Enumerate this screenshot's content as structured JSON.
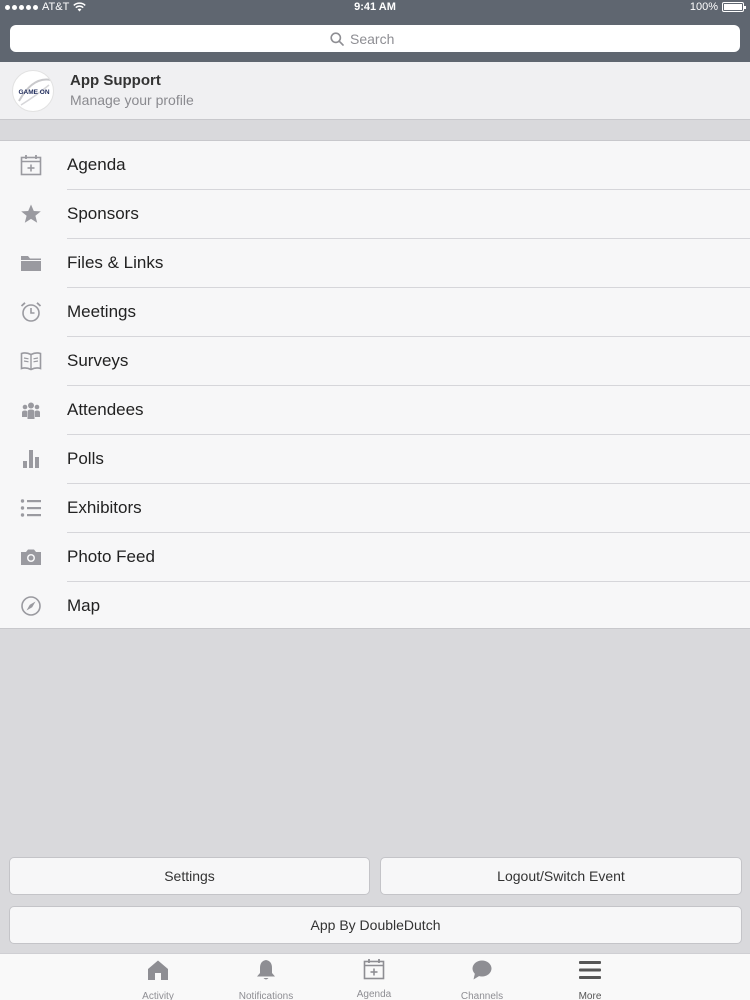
{
  "status_bar": {
    "carrier": "AT&T",
    "time": "9:41 AM",
    "battery": "100%"
  },
  "search": {
    "placeholder": "Search"
  },
  "profile": {
    "avatar_text": "GAME ON",
    "title": "App Support",
    "subtitle": "Manage your profile"
  },
  "menu": {
    "items": [
      {
        "label": "Agenda",
        "icon": "calendar-icon"
      },
      {
        "label": "Sponsors",
        "icon": "star-icon"
      },
      {
        "label": "Files & Links",
        "icon": "folder-icon"
      },
      {
        "label": "Meetings",
        "icon": "alarm-clock-icon"
      },
      {
        "label": "Surveys",
        "icon": "open-book-icon"
      },
      {
        "label": "Attendees",
        "icon": "people-icon"
      },
      {
        "label": "Polls",
        "icon": "bar-chart-icon"
      },
      {
        "label": "Exhibitors",
        "icon": "list-icon"
      },
      {
        "label": "Photo Feed",
        "icon": "camera-icon"
      },
      {
        "label": "Map",
        "icon": "compass-icon"
      }
    ]
  },
  "buttons": {
    "settings": "Settings",
    "logout": "Logout/Switch Event",
    "credit": "App By DoubleDutch"
  },
  "tabs": [
    {
      "label": "Activity",
      "icon": "home-icon"
    },
    {
      "label": "Notifications",
      "icon": "bell-icon"
    },
    {
      "label": "Agenda",
      "icon": "calendar-icon"
    },
    {
      "label": "Channels",
      "icon": "chat-bubble-icon"
    },
    {
      "label": "More",
      "icon": "menu-icon",
      "active": true
    }
  ],
  "colors": {
    "header": "#5f6670",
    "background": "#d9d9dc",
    "icon_gray": "#9a9aa0",
    "active_tab": "#555555"
  }
}
